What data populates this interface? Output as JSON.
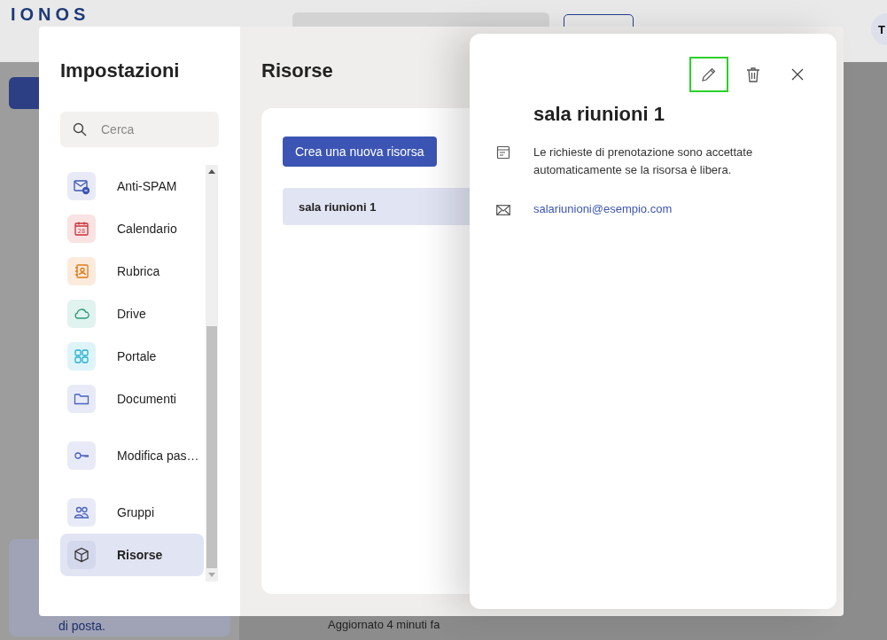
{
  "app": {
    "logo": "IONOS",
    "avatar": "T",
    "promo_text": "di posta.",
    "status": "Aggiornato 4 minuti fa"
  },
  "settings": {
    "title": "Impostazioni",
    "search": {
      "placeholder": "Cerca"
    },
    "items": [
      {
        "label": "Anti-SPAM",
        "kind": "spam",
        "selected": false
      },
      {
        "label": "Calendario",
        "kind": "calendar",
        "icon_text": "28",
        "selected": false
      },
      {
        "label": "Rubrica",
        "kind": "contacts",
        "selected": false
      },
      {
        "label": "Drive",
        "kind": "drive",
        "selected": false
      },
      {
        "label": "Portale",
        "kind": "portal",
        "selected": false
      },
      {
        "label": "Documenti",
        "kind": "documents",
        "selected": false
      },
      {
        "label": "Modifica pas…",
        "kind": "password",
        "selected": false
      },
      {
        "label": "Gruppi",
        "kind": "groups",
        "selected": false
      },
      {
        "label": "Risorse",
        "kind": "resources",
        "selected": true
      }
    ]
  },
  "resources": {
    "title": "Risorse",
    "new_button": "Crea una nuova risorsa",
    "list": [
      {
        "name": "sala riunioni 1",
        "selected": true
      }
    ]
  },
  "detail": {
    "actions": [
      {
        "kind": "edit",
        "highlighted": true
      },
      {
        "kind": "delete",
        "highlighted": false
      },
      {
        "kind": "close",
        "highlighted": false
      }
    ],
    "title": "sala riunioni 1",
    "note": "Le richieste di prenotazione sono accettate automaticamente se la risorsa è libera.",
    "email": "salariunioni@esempio.com"
  }
}
